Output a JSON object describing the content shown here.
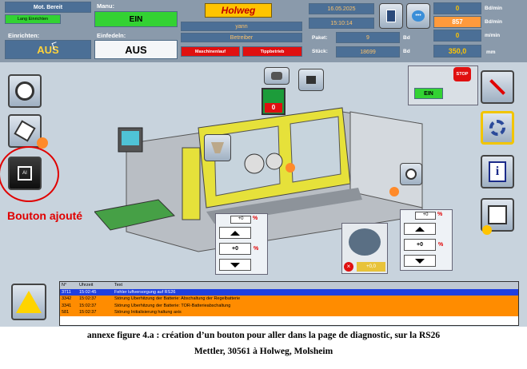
{
  "header": {
    "mot_bereit": "Mot. Bereit",
    "lang_einrichten": "Lang Einrichten",
    "einrichten_label": "Einrichten:",
    "einrichten_value": "AUS",
    "manu_label": "Manu:",
    "manu_value": "EIN",
    "einfedeln_label": "Einfedeln:",
    "einfedeln_value": "AUS",
    "brand": "Holweg",
    "user": "yann",
    "role": "Betreiber",
    "maschinenlauf": "Maschinenlauf",
    "tippbetrieb": "Tippbetrieb",
    "date": "16.05.2025",
    "time": "15:10:14",
    "paket_label": "Paket:",
    "paket_value": "9",
    "paket_unit": "Bd",
    "stueck_label": "Stück:",
    "stueck_value": "18699",
    "stueck_unit": "Bd",
    "rate1_value": "0",
    "rate1_unit": "Bd/min",
    "rate2_value": "857",
    "rate2_unit": "Bd/min",
    "rate3_value": "0",
    "rate3_unit": "m/min",
    "length_value": "350,0",
    "length_unit": "mm"
  },
  "machine": {
    "ein_button": "EIN",
    "stop_label": "STOP",
    "red_value": "0",
    "step_left": {
      "value": "+0",
      "unit": "%",
      "center": "+0"
    },
    "step_right": {
      "value": "+0",
      "unit": "%",
      "center": "+0"
    },
    "valve_value": "+0,0"
  },
  "annotation": "Bouton ajouté",
  "alarms": {
    "headers": [
      "N°",
      "Uhrzeit",
      "Text"
    ],
    "rows": [
      {
        "no": "3711",
        "time": "15:02:45",
        "text": "Fehler luftversorgung auf RS26",
        "color": "#1f3fe0",
        "fg": "#ffffff"
      },
      {
        "no": "3342",
        "time": "15:02:37",
        "text": "Störung Überhitzung der Batterie: Abschaltung der Regelbatterie",
        "color": "#ff8c00",
        "fg": "#000000"
      },
      {
        "no": "3341",
        "time": "15:02:37",
        "text": "Störung Überhitzung der Batterie: TOR-Batterieabschaltung",
        "color": "#ff8c00",
        "fg": "#000000"
      },
      {
        "no": "581",
        "time": "15:02:37",
        "text": "Störung Initialisierung haltung axis",
        "color": "#ff8c00",
        "fg": "#000000"
      }
    ]
  },
  "caption": {
    "line1": "annexe figure 4.a : création d’un bouton pour aller dans la page de diagnostic, sur la RS26",
    "line2": "Mettler, 30561 à Holweg, Molsheim"
  }
}
